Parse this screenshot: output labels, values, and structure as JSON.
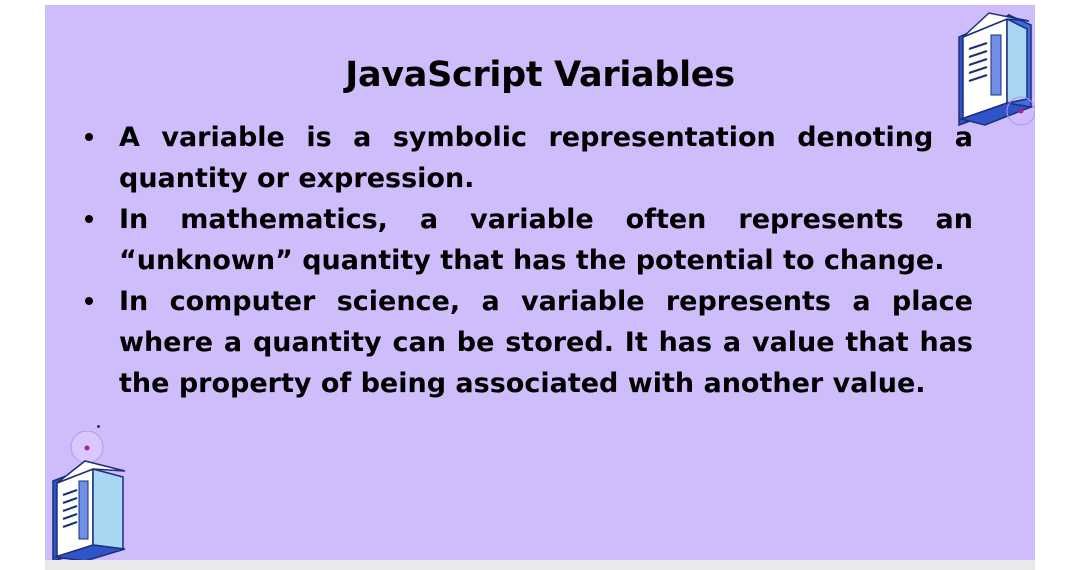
{
  "slide": {
    "title": "JavaScript Variables",
    "bullets": [
      "A variable is a symbolic representation denoting a quantity or expression.",
      "In mathematics, a variable often represents an “unknown” quantity that has the potential to change.",
      "In computer science, a variable represents a place where a quantity can be stored.  It has a value that has the property of being associated with another value."
    ],
    "background_color": "#cfbdfb"
  },
  "icons": {
    "top_right": "server-rack-icon",
    "bottom_left": "server-rack-icon"
  }
}
